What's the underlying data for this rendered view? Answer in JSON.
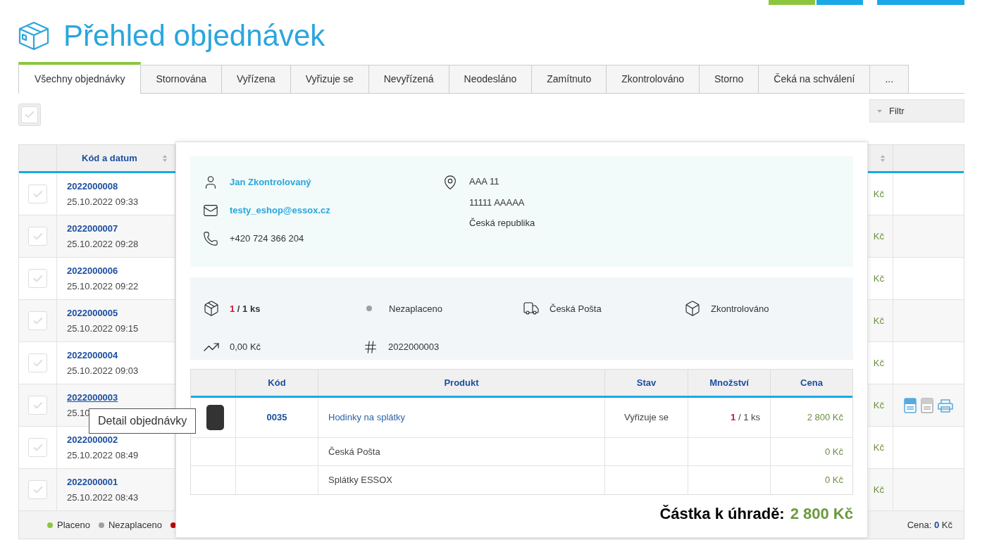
{
  "header": {
    "title": "Přehled objednávek",
    "top_buttons": [
      {
        "color": "#8cc63f"
      },
      {
        "color": "#1aa9e6"
      },
      {
        "color": "#1aa9e6"
      }
    ]
  },
  "tabs": [
    {
      "label": "Všechny objednávky",
      "selected": true
    },
    {
      "label": "Stornována",
      "selected": false
    },
    {
      "label": "Vyřízena",
      "selected": false
    },
    {
      "label": "Vyřizuje se",
      "selected": false
    },
    {
      "label": "Nevyřízená",
      "selected": false
    },
    {
      "label": "Neodesláno",
      "selected": false
    },
    {
      "label": "Zamítnuto",
      "selected": false
    },
    {
      "label": "Zkontrolováno",
      "selected": false
    },
    {
      "label": "Storno",
      "selected": false
    },
    {
      "label": "Čeká na schválení",
      "selected": false
    },
    {
      "label": "...",
      "selected": false
    }
  ],
  "toolbar": {
    "select_all_checked": false,
    "filter_label": "Filtr"
  },
  "orders_table": {
    "code_column": "Kód a datum",
    "rows": [
      {
        "code": "2022000008",
        "date": "25.10.2022 09:33",
        "price": "Kč",
        "checked": false,
        "hovered": false,
        "show_actions": false
      },
      {
        "code": "2022000007",
        "date": "25.10.2022 09:28",
        "price": "Kč",
        "checked": false,
        "hovered": false,
        "show_actions": false
      },
      {
        "code": "2022000006",
        "date": "25.10.2022 09:22",
        "price": "Kč",
        "checked": false,
        "hovered": false,
        "show_actions": false
      },
      {
        "code": "2022000005",
        "date": "25.10.2022 09:15",
        "price": "Kč",
        "checked": false,
        "hovered": false,
        "show_actions": false
      },
      {
        "code": "2022000004",
        "date": "25.10.2022 09:03",
        "price": "Kč",
        "checked": false,
        "hovered": false,
        "show_actions": false
      },
      {
        "code": "2022000003",
        "date": "25.10",
        "price": "Kč",
        "checked": false,
        "hovered": true,
        "show_actions": true
      },
      {
        "code": "2022000002",
        "date": "25.10.2022 08:49",
        "price": "Kč",
        "checked": false,
        "hovered": false,
        "show_actions": false
      },
      {
        "code": "2022000001",
        "date": "25.10.2022 08:43",
        "price": "Kč",
        "checked": false,
        "hovered": false,
        "show_actions": false
      }
    ],
    "legend": [
      {
        "label": "Placeno",
        "color": "#8cc63f"
      },
      {
        "label": "Nezaplaceno",
        "color": "#a0a0a0"
      },
      {
        "color": "#c00000"
      }
    ],
    "total_label": "Cena:",
    "total_value": "0",
    "total_currency": "Kč"
  },
  "order_detail": {
    "customer": {
      "name": "Jan Zkontrolovaný",
      "email": "testy_eshop@essox.cz",
      "phone": "+420 724 366 204"
    },
    "address": [
      "AAA 11",
      "11111 AAAAA",
      "Česká republika"
    ],
    "summary": {
      "qty_done": "1",
      "qty_total": "/ 1 ks",
      "payment": "Nezaplaceno",
      "shipping": "Česká Pošta",
      "status": "Zkontrolováno",
      "amount": "0,00 Kč",
      "number": "2022000003"
    },
    "items_table": {
      "columns": [
        "Kód",
        "Produkt",
        "Stav",
        "Množství",
        "Cena"
      ],
      "rows": [
        {
          "kind": "product",
          "code": "0035",
          "name": "Hodinky na splátky",
          "status": "Vyřizuje se",
          "qty_done": "1",
          "qty_total": "/ 1 ks",
          "price": "2 800 Kč"
        },
        {
          "kind": "fee",
          "name": "Česká Pošta",
          "price": "0 Kč"
        },
        {
          "kind": "fee",
          "name": "Splátky ESSOX",
          "price": "0 Kč"
        }
      ]
    },
    "total_label": "Částka k úhradě:",
    "total_value": "2 800 Kč"
  },
  "tooltip": "Detail objednávky"
}
